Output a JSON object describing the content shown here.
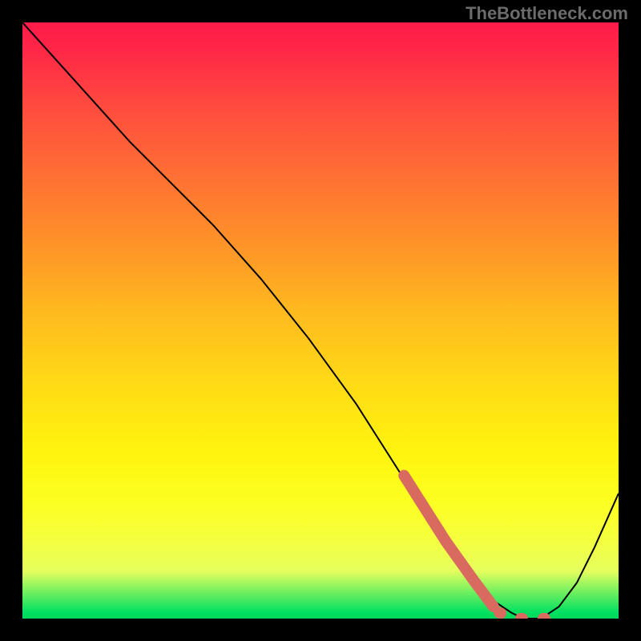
{
  "watermark": "TheBottleneck.com",
  "chart_data": {
    "type": "line",
    "title": "",
    "xlabel": "",
    "ylabel": "",
    "xlim": [
      0,
      100
    ],
    "ylim": [
      0,
      100
    ],
    "grid": false,
    "series": [
      {
        "name": "curve",
        "x": [
          0,
          9,
          18,
          25,
          32,
          40,
          48,
          56,
          63,
          68,
          73,
          76,
          79,
          82,
          84,
          87,
          90,
          93,
          96,
          100
        ],
        "y": [
          100,
          90,
          80,
          73,
          66,
          57,
          47,
          36,
          25,
          17,
          10,
          6,
          3,
          1,
          0,
          0,
          2,
          6,
          12,
          21
        ]
      }
    ],
    "highlight": {
      "thick_segment_x": [
        64,
        71,
        76,
        79
      ],
      "thick_segment_y": [
        24,
        13,
        6,
        2
      ],
      "dotted_segment_x": [
        80,
        83,
        86,
        88
      ],
      "dotted_segment_y": [
        1,
        0,
        0,
        0
      ]
    },
    "background_gradient_stops": [
      {
        "pct": 0,
        "color": "#ff1a4a"
      },
      {
        "pct": 50,
        "color": "#ffd916"
      },
      {
        "pct": 96,
        "color": "#e6ff5e"
      },
      {
        "pct": 100,
        "color": "#00d858"
      }
    ]
  }
}
